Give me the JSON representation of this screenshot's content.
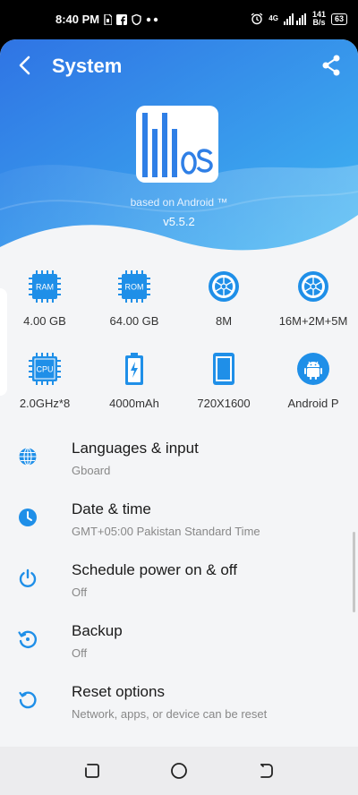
{
  "status_bar": {
    "time": "8:40 PM",
    "left_icons": [
      "sim-card-icon",
      "facebook-icon",
      "shield-icon",
      "more-dots-icon"
    ],
    "network": "4G",
    "speed_value": "141",
    "speed_unit": "B/s",
    "battery": "63"
  },
  "header": {
    "title": "System",
    "based_on": "based on Android ™",
    "version": "v5.5.2",
    "colors": {
      "gradient_start": "#2f74e4",
      "gradient_end": "#3fb6f2"
    }
  },
  "specs": [
    {
      "icon": "ram-chip-icon",
      "icon_text": "RAM",
      "label": "4.00 GB"
    },
    {
      "icon": "rom-chip-icon",
      "icon_text": "ROM",
      "label": "64.00 GB"
    },
    {
      "icon": "front-camera-icon",
      "label": "8M"
    },
    {
      "icon": "rear-camera-icon",
      "label": "16M+2M+5M"
    },
    {
      "icon": "cpu-chip-icon",
      "icon_text": "CPU",
      "label": "2.0GHz*8"
    },
    {
      "icon": "battery-icon",
      "label": "4000mAh"
    },
    {
      "icon": "screen-icon",
      "label": "720X1600"
    },
    {
      "icon": "android-icon",
      "label": "Android P"
    }
  ],
  "settings": [
    {
      "icon": "globe-icon",
      "title": "Languages & input",
      "subtitle": "Gboard"
    },
    {
      "icon": "clock-icon",
      "title": "Date & time",
      "subtitle": "GMT+05:00 Pakistan Standard Time"
    },
    {
      "icon": "power-icon",
      "title": "Schedule power on & off",
      "subtitle": "Off"
    },
    {
      "icon": "backup-icon",
      "title": "Backup",
      "subtitle": "Off"
    },
    {
      "icon": "reset-icon",
      "title": "Reset options",
      "subtitle": "Network, apps, or device can be reset"
    }
  ],
  "accent_color": "#1f8fe8"
}
